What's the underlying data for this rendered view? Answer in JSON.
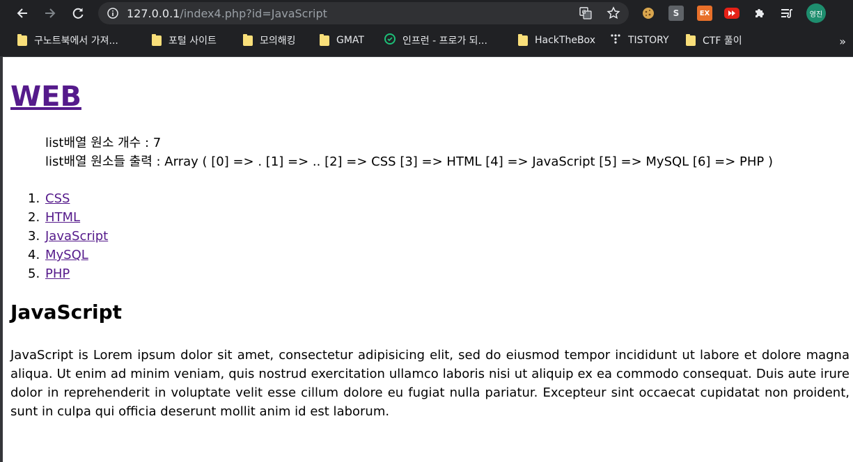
{
  "browser": {
    "url_host": "127.0.0.1",
    "url_path": "/index4.php?id=JavaScript",
    "profile_label": "영진",
    "extensions": [
      {
        "name": "cookie-icon",
        "label": ""
      },
      {
        "name": "s-extension-icon",
        "label": "S"
      },
      {
        "name": "ex-extension-icon",
        "label": "EX"
      },
      {
        "name": "youtube-extension-icon",
        "label": ""
      }
    ],
    "bookmarks": [
      {
        "label": "구노트북에서 가져...",
        "icon": "folder"
      },
      {
        "label": "포털 사이트",
        "icon": "folder"
      },
      {
        "label": "모의해킹",
        "icon": "folder"
      },
      {
        "label": "GMAT",
        "icon": "folder"
      },
      {
        "label": "인프런 - 프로가 되...",
        "icon": "inflearn"
      },
      {
        "label": "HackTheBox",
        "icon": "folder"
      },
      {
        "label": "TISTORY",
        "icon": "tistory"
      },
      {
        "label": "CTF 풀이",
        "icon": "folder"
      }
    ],
    "bookmarks_overflow": "»"
  },
  "page": {
    "title": "WEB",
    "count_line": "list배열 원소 개수 : 7",
    "array_line": "list배열 원소들 출력 : Array ( [0] => . [1] => .. [2] => CSS [3] => HTML [4] => JavaScript [5] => MySQL [6] => PHP )",
    "list": [
      {
        "num": "1.",
        "label": "CSS"
      },
      {
        "num": "2.",
        "label": "HTML"
      },
      {
        "num": "3.",
        "label": "JavaScript"
      },
      {
        "num": "4.",
        "label": "MySQL"
      },
      {
        "num": "5.",
        "label": "PHP"
      }
    ],
    "heading": "JavaScript",
    "description": "JavaScript is Lorem ipsum dolor sit amet, consectetur adipisicing elit, sed do eiusmod tempor incididunt ut labore et dolore magna aliqua. Ut enim ad minim veniam, quis nostrud exercitation ullamco laboris nisi ut aliquip ex ea commodo consequat. Duis aute irure dolor in reprehenderit in voluptate velit esse cillum dolore eu fugiat nulla pariatur. Excepteur sint occaecat cupidatat non proident, sunt in culpa qui officia deserunt mollit anim id est laborum."
  },
  "colors": {
    "chrome_bg": "#202124",
    "omnibox_bg": "#303134",
    "visited_link": "#551a8b"
  }
}
